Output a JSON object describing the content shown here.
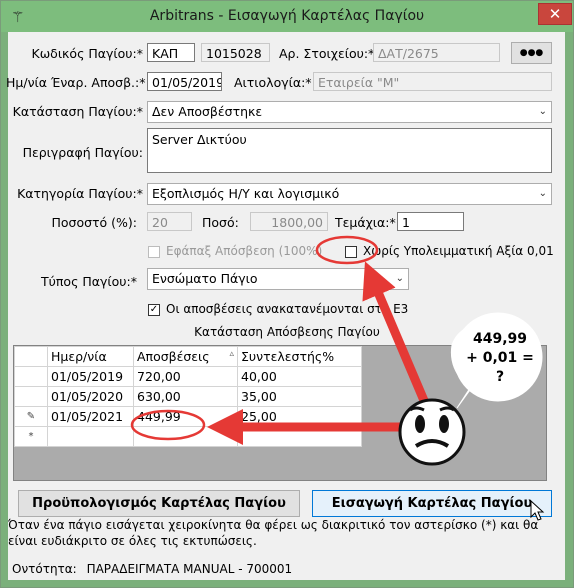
{
  "window": {
    "title": "Arbitrans - Εισαγωγή Καρτέλας Παγίου",
    "close_glyph": "✕",
    "app_icon": "arbitrans-logo-icon"
  },
  "form": {
    "code_label": "Κωδικός Παγίου:*",
    "code_prefix": "ΚΑΠ",
    "code_number": "1015028",
    "doc_label": "Αρ. Στοιχείου:*",
    "doc_value": "ΔΑΤ/2675",
    "dots_label": "●●●",
    "date_label": "Ημ/νία Έναρ. Αποσβ.:*",
    "date_value": "01/05/2019",
    "reason_label": "Αιτιολογία:*",
    "reason_value": "Εταιρεία \"Μ\"",
    "status_label": "Κατάσταση Παγίου:*",
    "status_value": "Δεν Αποσβέστηκε",
    "desc_label": "Περιγραφή Παγίου:",
    "desc_value": "Server Δικτύου",
    "category_label": "Κατηγορία Παγίου:*",
    "category_value": "Εξοπλισμός Η/Υ και λογισμικό",
    "percent_label": "Ποσοστό (%):",
    "percent_value": "20",
    "amount_label": "Ποσό:",
    "amount_value": "1800,00",
    "pieces_label": "Τεμάχια:*",
    "pieces_value": "1",
    "once_label": "Εφάπαξ Απόσβεση (100%)",
    "noresidual_label": "Χωρίς Υπολειμματική Αξία 0,01",
    "type_label": "Τύπος Παγίου:*",
    "type_value": "Ενσώματο Πάγιο",
    "redistribute_label": "Οι αποσβέσεις ανακατανέμονται στο Ε3",
    "section_title": "Κατάσταση Απόσβεσης Παγίου"
  },
  "grid": {
    "headers": [
      "Ημερ/νία",
      "Αποσβέσεις",
      "Συντελεστής%"
    ],
    "rows": [
      [
        "01/05/2019",
        "720,00",
        "40,00"
      ],
      [
        "01/05/2020",
        "630,00",
        "35,00"
      ],
      [
        "01/05/2021",
        "449,99",
        "25,00"
      ]
    ],
    "new_row_marker": "*",
    "edit_marker": "✎"
  },
  "buttons": {
    "budget": "Προϋπολογισμός Καρτέλας Παγίου",
    "insert": "Εισαγωγή Καρτέλας Παγίου"
  },
  "note": "Όταν ένα πάγιο εισάγεται χειροκίνητα θα φέρει ως διακριτικό τον αστερίσκο (*) και θα είναι ευδιάκριτο σε όλες τις εκτυπώσεις.",
  "status": {
    "entity_label": "Οντότητα:",
    "entity_value": "ΠΑΡΑΔΕΙΓΜΑΤΑ MANUAL  -  700001"
  },
  "annotation": {
    "bubble_text": "449,99 + 0,01 = ?",
    "accent": "#e53935"
  }
}
